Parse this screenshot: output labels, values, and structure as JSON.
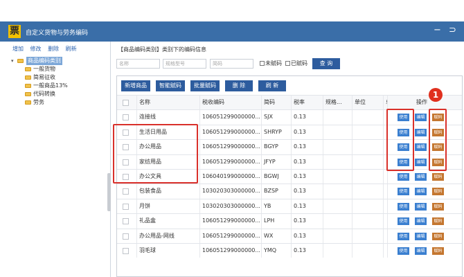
{
  "window": {
    "title": "自定义货物与劳务编码",
    "minimize_glyph": "−",
    "close_glyph": "⊃",
    "logo_glyph": "票"
  },
  "sidebar": {
    "toolbar": [
      "增加",
      "修改",
      "删除",
      "刷新"
    ],
    "root": "商品编码类别",
    "items": [
      "一般货物",
      "简易征收",
      "一般商品13%",
      "代码转换",
      "劳务"
    ]
  },
  "main": {
    "section_title": "【商品编码类别】类别下的编码信息",
    "filters": {
      "name_placeholder": "名称",
      "spec_placeholder": "规格型号",
      "code_placeholder": "简码",
      "unassigned_label": "未赋码",
      "assigned_label": "已赋码",
      "query_label": "查 询"
    },
    "actions": [
      "新增商品",
      "智能赋码",
      "批量赋码",
      "删 除",
      "刷 新"
    ],
    "columns": [
      "名称",
      "税收编码",
      "简码",
      "税率",
      "规格...",
      "单位",
      "单",
      "操作"
    ],
    "op_labels": {
      "use": "使用",
      "edit": "编辑",
      "assign": "赋码"
    },
    "rows": [
      {
        "name": "连接线",
        "tax_code": "106051299000000...",
        "short": "SJX",
        "rate": "0.13"
      },
      {
        "name": "生活日用品",
        "tax_code": "106051299000000...",
        "short": "SHRYP",
        "rate": "0.13"
      },
      {
        "name": "办公用品",
        "tax_code": "106051299000000...",
        "short": "BGYP",
        "rate": "0.13"
      },
      {
        "name": "家纺用品",
        "tax_code": "106051299000000...",
        "short": "JFYP",
        "rate": "0.13"
      },
      {
        "name": "办公文具",
        "tax_code": "106040199000000...",
        "short": "BGWJ",
        "rate": "0.13"
      },
      {
        "name": "包装食品",
        "tax_code": "103020303000000...",
        "short": "BZSP",
        "rate": "0.13"
      },
      {
        "name": "月饼",
        "tax_code": "103020303000000...",
        "short": "YB",
        "rate": "0.13"
      },
      {
        "name": "礼品盒",
        "tax_code": "106051299000000...",
        "short": "LPH",
        "rate": "0.13"
      },
      {
        "name": "办公用品-网线",
        "tax_code": "106051299000000...",
        "short": "WX",
        "rate": "0.13"
      },
      {
        "name": "羽毛球",
        "tax_code": "106051299000000...",
        "short": "YMQ",
        "rate": "0.13"
      }
    ]
  },
  "annotation": {
    "badge": "1"
  },
  "colors": {
    "titlebar": "#3a6ea8",
    "primary_button": "#2d5c9e",
    "assign_button": "#c4762f",
    "highlight": "#d9302a"
  }
}
